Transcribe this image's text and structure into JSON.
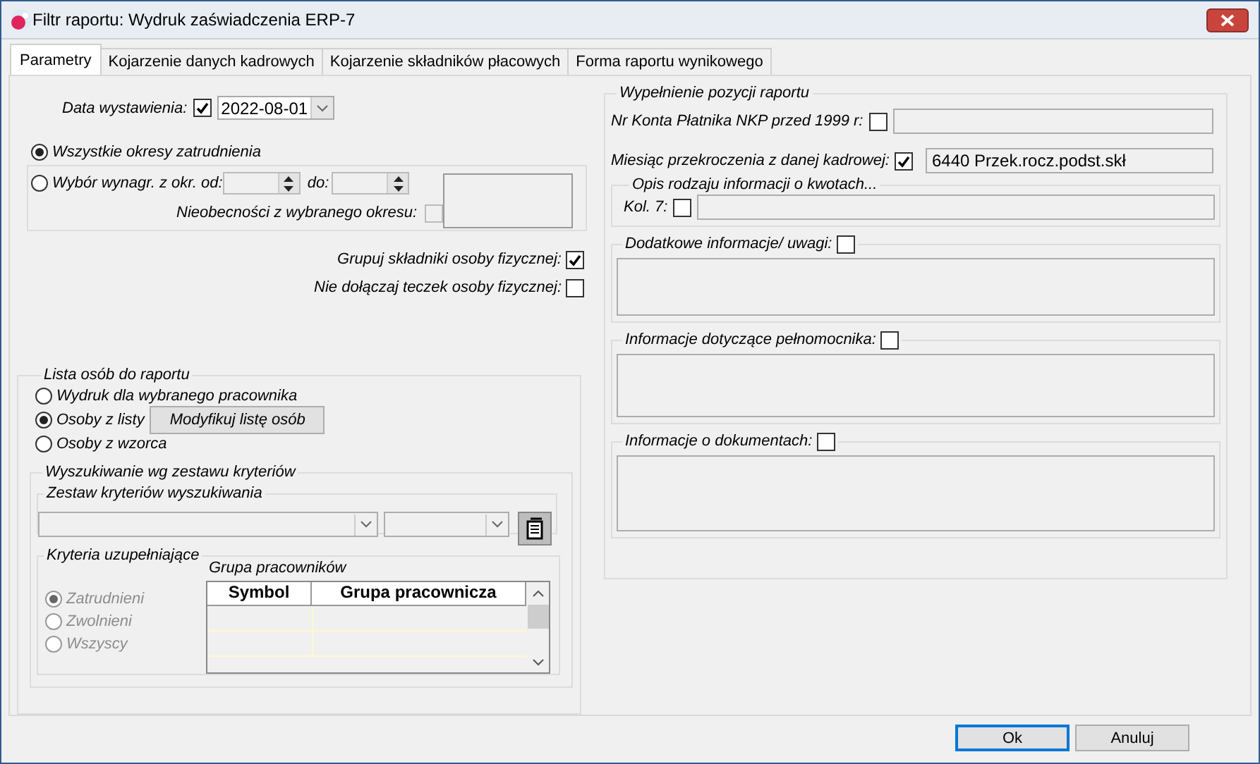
{
  "window": {
    "title": "Filtr raportu: Wydruk zaświadczenia ERP-7"
  },
  "tabs": [
    {
      "label": "Parametry",
      "selected": true
    },
    {
      "label": "Kojarzenie danych kadrowych",
      "selected": false
    },
    {
      "label": "Kojarzenie składników płacowych",
      "selected": false
    },
    {
      "label": "Forma raportu wynikowego",
      "selected": false
    }
  ],
  "issue_date": {
    "label": "Data wystawienia:",
    "checked": true,
    "value": "2022-08-01"
  },
  "period": {
    "options": [
      {
        "label": "Wszystkie okresy zatrudnienia",
        "selected": true
      },
      {
        "label": "Wybór wynagr. z okr. od:",
        "selected": false
      }
    ],
    "to_label": "do:",
    "absences": {
      "label": "Nieobecności z wybranego okresu:",
      "checked": false,
      "disabled": true
    }
  },
  "options": [
    {
      "label": "Grupuj składniki osoby fizycznej:",
      "checked": true
    },
    {
      "label": "Nie dołączaj teczek osoby fizycznej:",
      "checked": false
    }
  ],
  "person_list": {
    "title": "Lista osób do raportu",
    "options": [
      {
        "label": "Wydruk dla wybranego pracownika",
        "selected": false
      },
      {
        "label": "Osoby z listy",
        "selected": true
      },
      {
        "label": "Osoby z wzorca",
        "selected": false
      }
    ],
    "modify_button": "Modyfikuj listę osób",
    "search": {
      "title": "Wyszukiwanie wg zestawu kryteriów",
      "criteria_set": {
        "title": "Zestaw kryteriów wyszukiwania"
      },
      "supplementary": {
        "title": "Kryteria uzupełniające",
        "options": [
          {
            "label": "Zatrudnieni",
            "selected": true,
            "disabled": true
          },
          {
            "label": "Zwolnieni",
            "selected": false,
            "disabled": true
          },
          {
            "label": "Wszyscy",
            "selected": false,
            "disabled": true
          }
        ],
        "group_label": "Grupa pracowników",
        "table": {
          "columns": [
            "Symbol",
            "Grupa pracownicza"
          ]
        }
      }
    }
  },
  "report_fill": {
    "title": "Wypełnienie pozycji raportu",
    "account": {
      "label": "Nr Konta Płatnika NKP przed 1999 r:",
      "checked": false
    },
    "month": {
      "label": "Miesiąc przekroczenia z danej kadrowej:",
      "checked": true,
      "value": "6440 Przek.rocz.podst.skł"
    },
    "amounts": {
      "title": "Opis rodzaju informacji o kwotach...",
      "label": "Kol. 7:",
      "checked": false
    },
    "notes": [
      {
        "label": "Dodatkowe informacje/ uwagi:",
        "checked": false
      },
      {
        "label": "Informacje dotyczące pełnomocnika:",
        "checked": false
      },
      {
        "label": "Informacje o dokumentach:",
        "checked": false
      }
    ]
  },
  "buttons": [
    {
      "label": "Ok",
      "default": true
    },
    {
      "label": "Anuluj",
      "default": false
    }
  ]
}
